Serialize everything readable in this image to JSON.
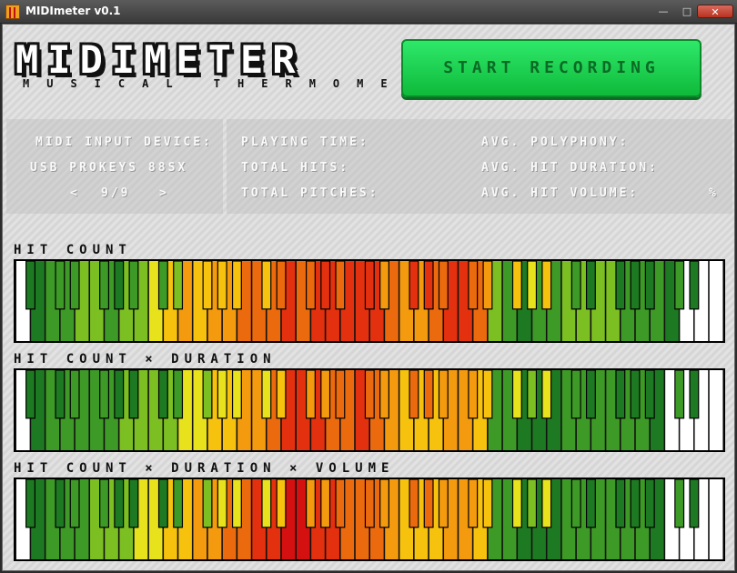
{
  "window": {
    "title": "MIDImeter v0.1",
    "minimize": "—",
    "maximize": "□",
    "close": "✕"
  },
  "header": {
    "logo": "MIDIMETER",
    "tagline": "MUSICAL THERMOMETER",
    "record_button": "START RECORDING"
  },
  "device_panel": {
    "label": "MIDI INPUT DEVICE:",
    "device_name": "USB PROKEYS 88SX",
    "prev": "<",
    "index": "9/9",
    "next": ">"
  },
  "stats": {
    "playing_time": "PLAYING TIME:",
    "total_hits": "TOTAL HITS:",
    "total_pitches": "TOTAL PITCHES:",
    "avg_polyphony": "AVG. POLYPHONY:",
    "avg_hit_duration": "AVG. HIT DURATION:",
    "avg_hit_volume": "AVG. HIT VOLUME:",
    "volume_unit": "%"
  },
  "colors": {
    "0": "#ffffff",
    "1": "#1e7a22",
    "2": "#3e9a26",
    "3": "#7cbf22",
    "4": "#e8e21c",
    "5": "#f7c20e",
    "6": "#f39a0e",
    "7": "#ec6a0e",
    "8": "#e3300e",
    "9": "#d41010"
  },
  "keyboards": [
    {
      "title": "HIT COUNT",
      "white_heat": "012233233456566777878888876678873212233332221000",
      "black_heat": "12221223555577878688776545211112111111100000"
    },
    {
      "title": "HIT COUNT × DURATION",
      "white_heat": "012222233334455667888778765556652211122222210000",
      "black_heat": "11221112344456677677665434211112111111100000"
    },
    {
      "title": "HIT COUNT × DURATION × VOLUME",
      "white_heat": "012223334455667788998877765556652211122222210000",
      "black_heat": "11221112344456677677665434211112111111100000"
    }
  ]
}
